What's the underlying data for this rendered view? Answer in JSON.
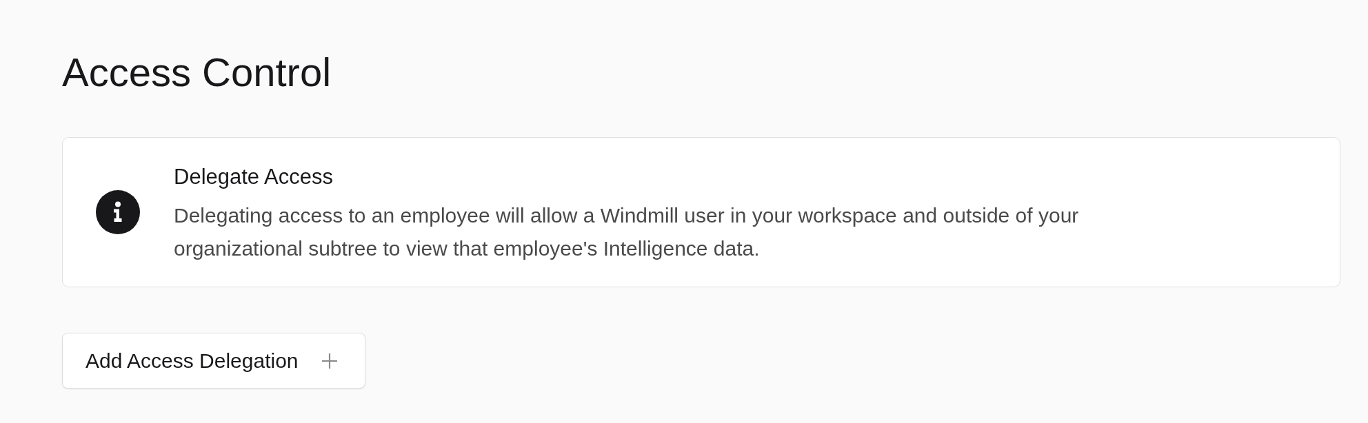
{
  "page": {
    "title": "Access Control"
  },
  "notice": {
    "heading": "Delegate Access",
    "body": "Delegating access to an employee will allow a Windmill user in your workspace and outside of your organizational subtree to view that employee's Intelligence data."
  },
  "add_button": {
    "label": "Add Access Delegation"
  }
}
